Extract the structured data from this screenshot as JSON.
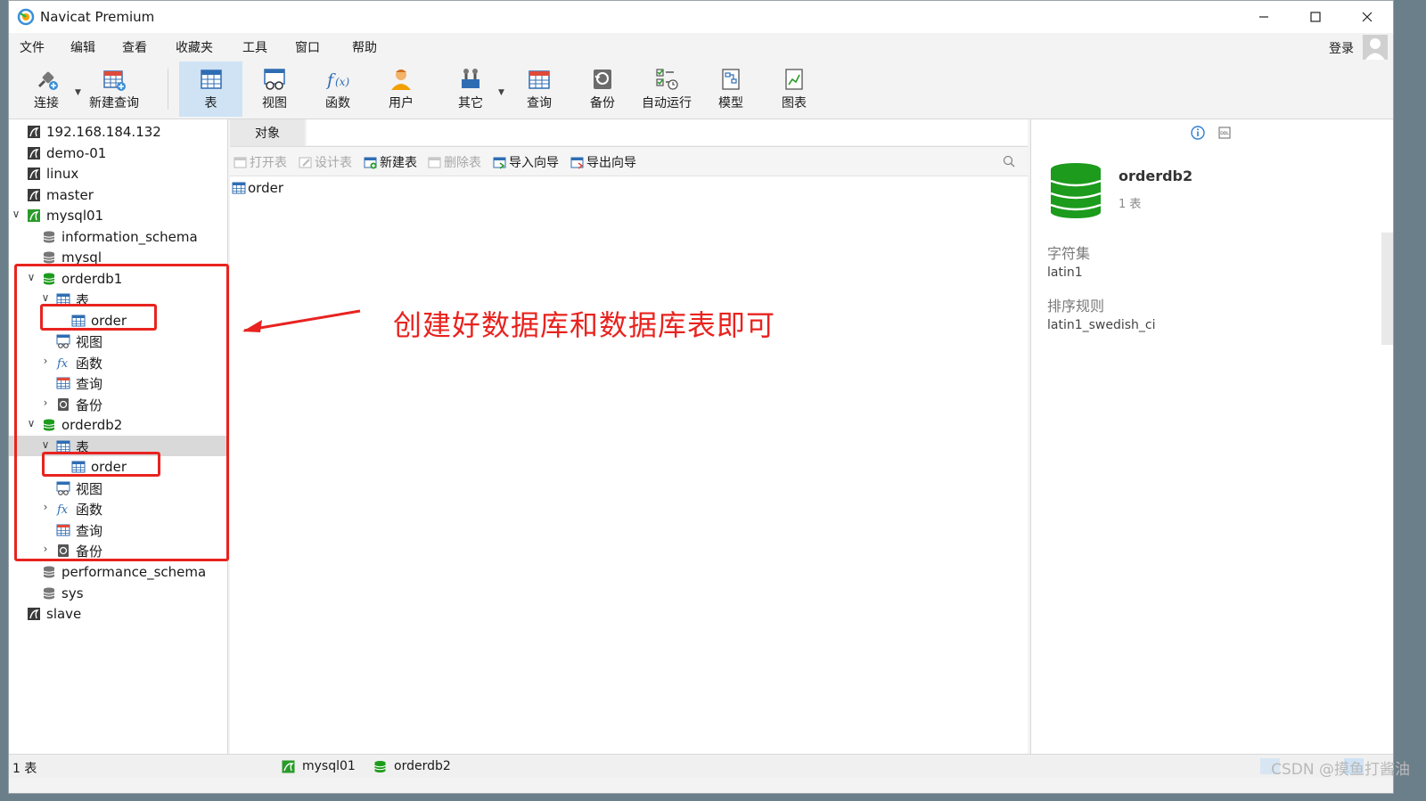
{
  "window": {
    "title": "Navicat Premium"
  },
  "menu": [
    "文件",
    "编辑",
    "查看",
    "收藏夹",
    "工具",
    "窗口",
    "帮助"
  ],
  "login_label": "登录",
  "toolbar": [
    {
      "label": "连接",
      "icon": "plug-connect-icon"
    },
    {
      "label": "新建查询",
      "icon": "new-query-icon"
    },
    {
      "label": "表",
      "icon": "table-icon",
      "active": true
    },
    {
      "label": "视图",
      "icon": "view-icon"
    },
    {
      "label": "函数",
      "icon": "function-icon"
    },
    {
      "label": "用户",
      "icon": "user-icon"
    },
    {
      "label": "其它",
      "icon": "tools-icon"
    },
    {
      "label": "查询",
      "icon": "query-icon"
    },
    {
      "label": "备份",
      "icon": "backup-icon"
    },
    {
      "label": "自动运行",
      "icon": "auto-run-icon"
    },
    {
      "label": "模型",
      "icon": "model-icon"
    },
    {
      "label": "图表",
      "icon": "chart-icon"
    }
  ],
  "tree": [
    {
      "label": "192.168.184.132",
      "type": "connection"
    },
    {
      "label": "demo-01",
      "type": "connection"
    },
    {
      "label": "linux",
      "type": "connection"
    },
    {
      "label": "master",
      "type": "connection"
    },
    {
      "label": "mysql01",
      "type": "connection-open"
    },
    {
      "label": "information_schema",
      "type": "database"
    },
    {
      "label": "mysql",
      "type": "database"
    },
    {
      "label": "orderdb1",
      "type": "database-open"
    },
    {
      "label": "表",
      "type": "tables"
    },
    {
      "label": "order",
      "type": "table"
    },
    {
      "label": "视图",
      "type": "views"
    },
    {
      "label": "函数",
      "type": "functions"
    },
    {
      "label": "查询",
      "type": "queries"
    },
    {
      "label": "备份",
      "type": "backups"
    },
    {
      "label": "orderdb2",
      "type": "database-open"
    },
    {
      "label": "表",
      "type": "tables"
    },
    {
      "label": "order",
      "type": "table"
    },
    {
      "label": "视图",
      "type": "views"
    },
    {
      "label": "函数",
      "type": "functions"
    },
    {
      "label": "查询",
      "type": "queries"
    },
    {
      "label": "备份",
      "type": "backups"
    },
    {
      "label": "performance_schema",
      "type": "database"
    },
    {
      "label": "sys",
      "type": "database"
    },
    {
      "label": "slave",
      "type": "connection"
    }
  ],
  "objects_tab": "对象",
  "object_toolbar": [
    {
      "label": "打开表",
      "enabled": false
    },
    {
      "label": "设计表",
      "enabled": false
    },
    {
      "label": "新建表",
      "enabled": true
    },
    {
      "label": "删除表",
      "enabled": false
    },
    {
      "label": "导入向导",
      "enabled": true
    },
    {
      "label": "导出向导",
      "enabled": true
    }
  ],
  "objects": [
    "order"
  ],
  "info": {
    "db_name": "orderdb2",
    "count": "1 表",
    "charset_label": "字符集",
    "charset": "latin1",
    "collation_label": "排序规则",
    "collation": "latin1_swedish_ci"
  },
  "status": {
    "count": "1 表",
    "connection": "mysql01",
    "database": "orderdb2"
  },
  "annotation": "创建好数据库和数据库表即可",
  "watermark": "CSDN @摸鱼打酱油",
  "colors": {
    "annotation_red": "#e8231f",
    "db_green": "#1c9b1c",
    "active_tab": "#cfe3f5",
    "selected_row": "#d9d9d9"
  }
}
